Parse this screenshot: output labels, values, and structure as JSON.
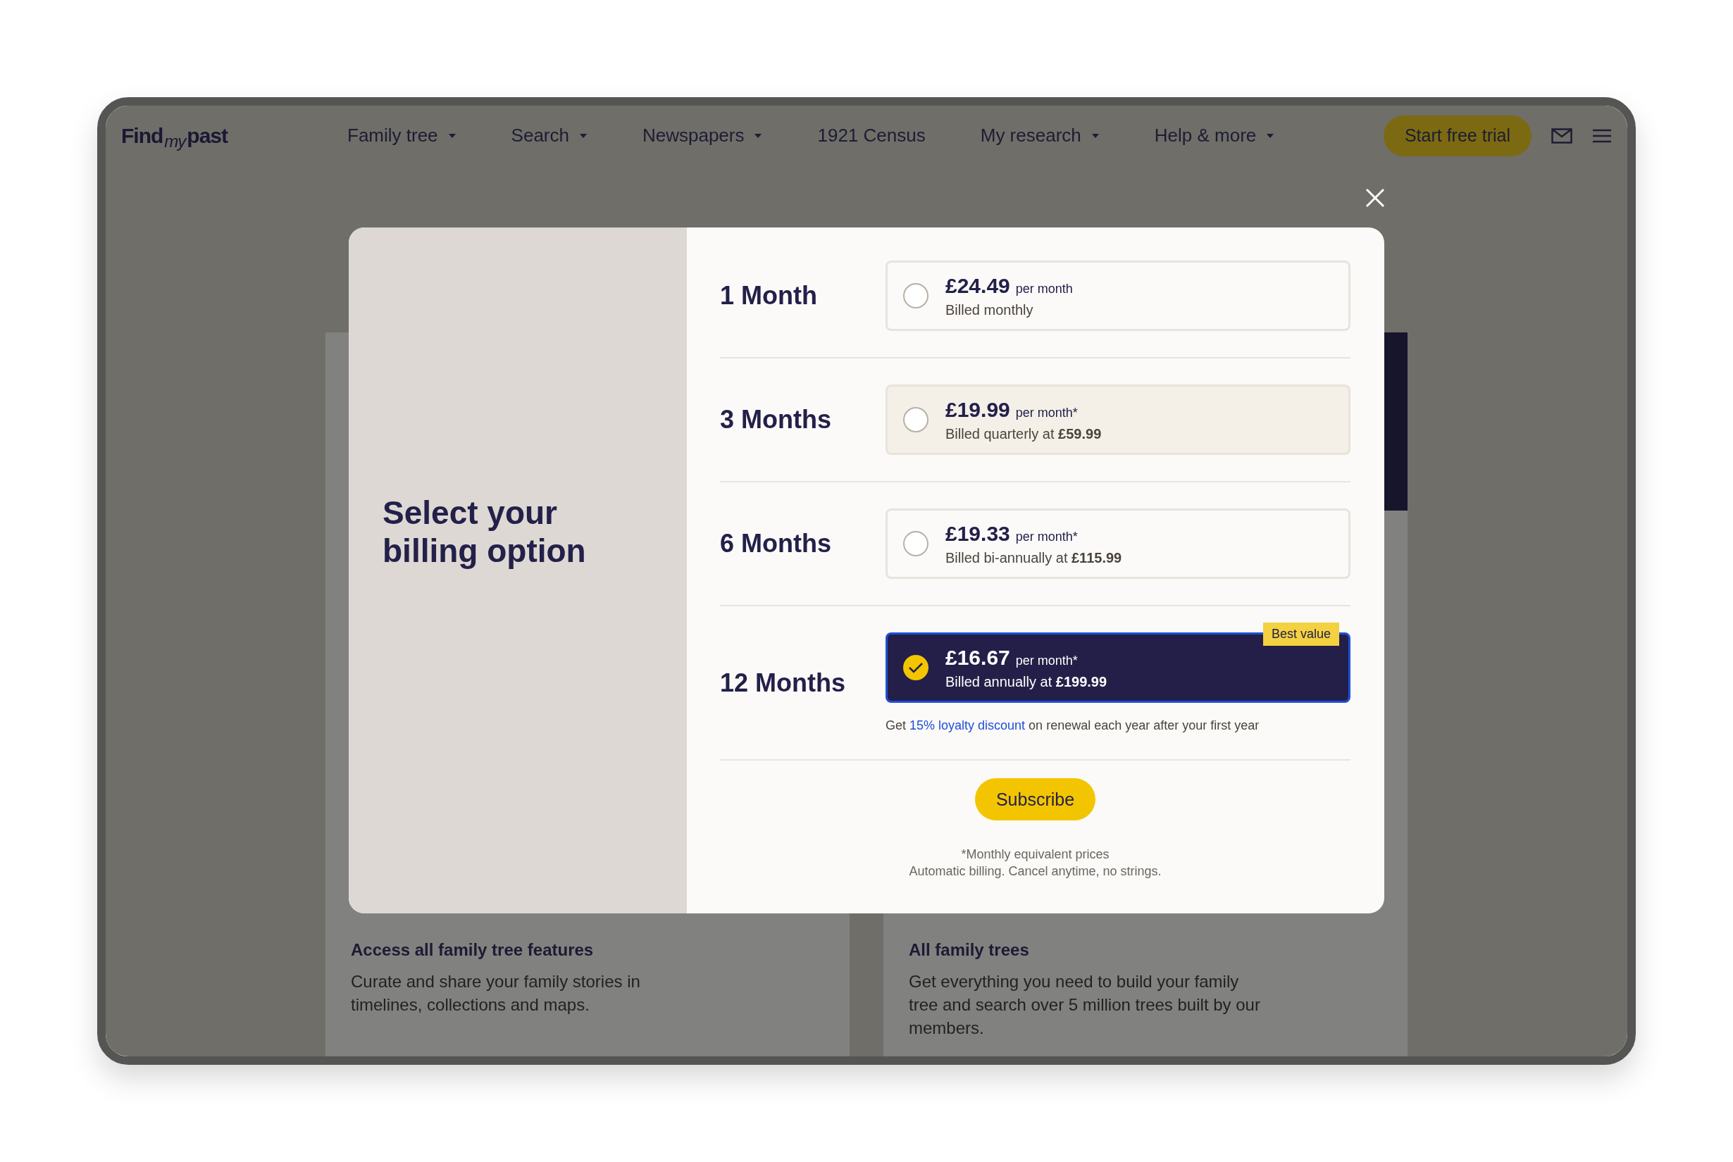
{
  "header": {
    "logo": {
      "first": "Find",
      "middle": "my",
      "last": "past"
    },
    "nav": [
      {
        "label": "Family tree",
        "dropdown": true
      },
      {
        "label": "Search",
        "dropdown": true
      },
      {
        "label": "Newspapers",
        "dropdown": true
      },
      {
        "label": "1921 Census",
        "dropdown": false
      },
      {
        "label": "My research",
        "dropdown": true
      },
      {
        "label": "Help & more",
        "dropdown": true
      }
    ],
    "trial_button": "Start free trial"
  },
  "background_cards": [
    {
      "title": "Access all family tree features",
      "text": "Curate and share your family stories in timelines, collections and maps.",
      "banner": false
    },
    {
      "title": "All family trees",
      "text": "Get everything you need to build your family tree and search over 5 million trees built by our members.",
      "banner": true
    }
  ],
  "modal": {
    "title": "Select your billing option",
    "options": [
      {
        "term": "1 Month",
        "price": "£24.49",
        "unit": "per month",
        "billing": "Billed monthly",
        "selected": false,
        "hovered": false
      },
      {
        "term": "3 Months",
        "price": "£19.99",
        "unit": "per month*",
        "billing": "Billed quarterly at **£59.99**",
        "selected": false,
        "hovered": true
      },
      {
        "term": "6 Months",
        "price": "£19.33",
        "unit": "per month*",
        "billing": "Billed bi-annually at **£115.99**",
        "selected": false,
        "hovered": false
      },
      {
        "term": "12 Months",
        "price": "£16.67",
        "unit": "per month*",
        "billing": "Billed annually at **£199.99**",
        "selected": true,
        "badge": "Best value",
        "note": {
          "before": "Get",
          "link": "15% loyalty discount",
          "after": "on renewal each year after your first year"
        }
      }
    ],
    "subscribe_button": "Subscribe",
    "footnotes": [
      "*Monthly equivalent prices",
      "Automatic billing. Cancel anytime, no strings."
    ]
  }
}
